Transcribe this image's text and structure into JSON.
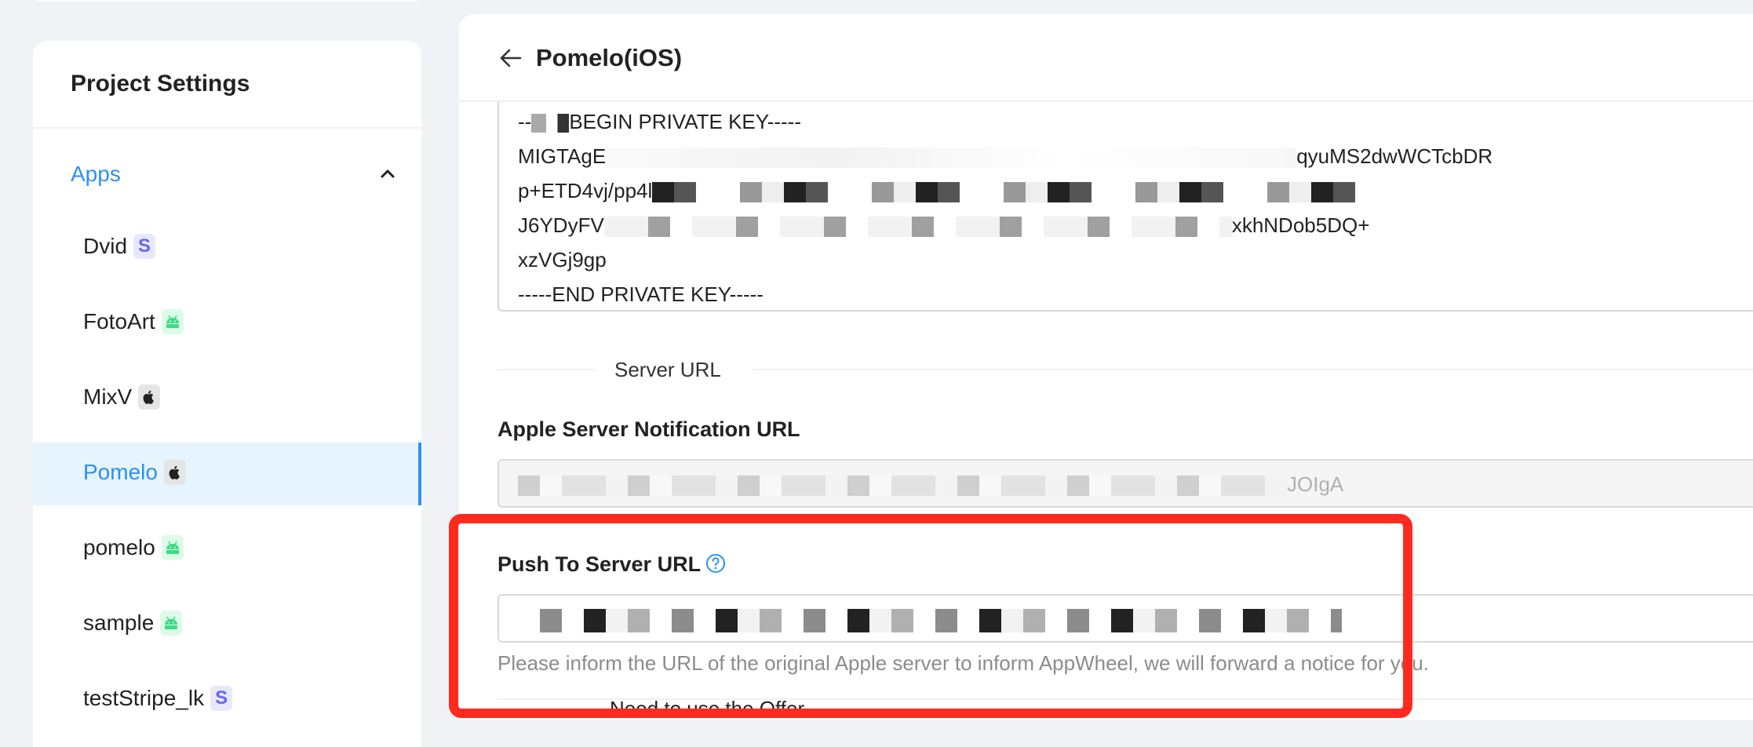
{
  "sidebar": {
    "title": "Project Settings",
    "group": {
      "label": "Apps",
      "expanded": true
    },
    "items": [
      {
        "label": "Dvid",
        "platform": "stripe",
        "badge_text": "S",
        "active": false
      },
      {
        "label": "FotoArt",
        "platform": "android",
        "active": false
      },
      {
        "label": "MixV",
        "platform": "ios",
        "active": false
      },
      {
        "label": "Pomelo",
        "platform": "ios",
        "active": true
      },
      {
        "label": "pomelo",
        "platform": "android",
        "active": false
      },
      {
        "label": "sample",
        "platform": "android",
        "active": false
      },
      {
        "label": "testStripe_lk",
        "platform": "stripe",
        "badge_text": "S",
        "active": false
      }
    ]
  },
  "header": {
    "title": "Pomelo(iOS)"
  },
  "private_key": {
    "lines": [
      {
        "prefix": "--",
        "suffix": "BEGIN PRIVATE KEY-----"
      },
      {
        "prefix": "MIGTAgE",
        "suffix": "qyuMS2dwWCTcbDR"
      },
      {
        "prefix": "p+ETD4vj/pp4l",
        "suffix": ""
      },
      {
        "prefix": "J6YDyFV",
        "suffix": "xkhNDob5DQ+"
      },
      {
        "prefix": "xzVGj9gp",
        "suffix": ""
      },
      {
        "prefix": "-----END PRIVATE KEY-----",
        "suffix": ""
      }
    ]
  },
  "server_url_section": {
    "label": "Server URL"
  },
  "apple_server_url": {
    "label": "Apple Server Notification URL",
    "value_visible_suffix": "JOIgA",
    "disabled": true
  },
  "push_to_server_url": {
    "label": "Push To Server URL",
    "value": "",
    "help": "Please inform the URL of the original Apple server to inform AppWheel, we will forward a notice for you."
  },
  "offer_section": {
    "label": "Need to use the Offer"
  },
  "colors": {
    "accent": "#2f8ff0",
    "annotation_red": "#ff2a1f",
    "active_bg": "#e6f5fd",
    "page_bg": "#f0f2f5"
  }
}
